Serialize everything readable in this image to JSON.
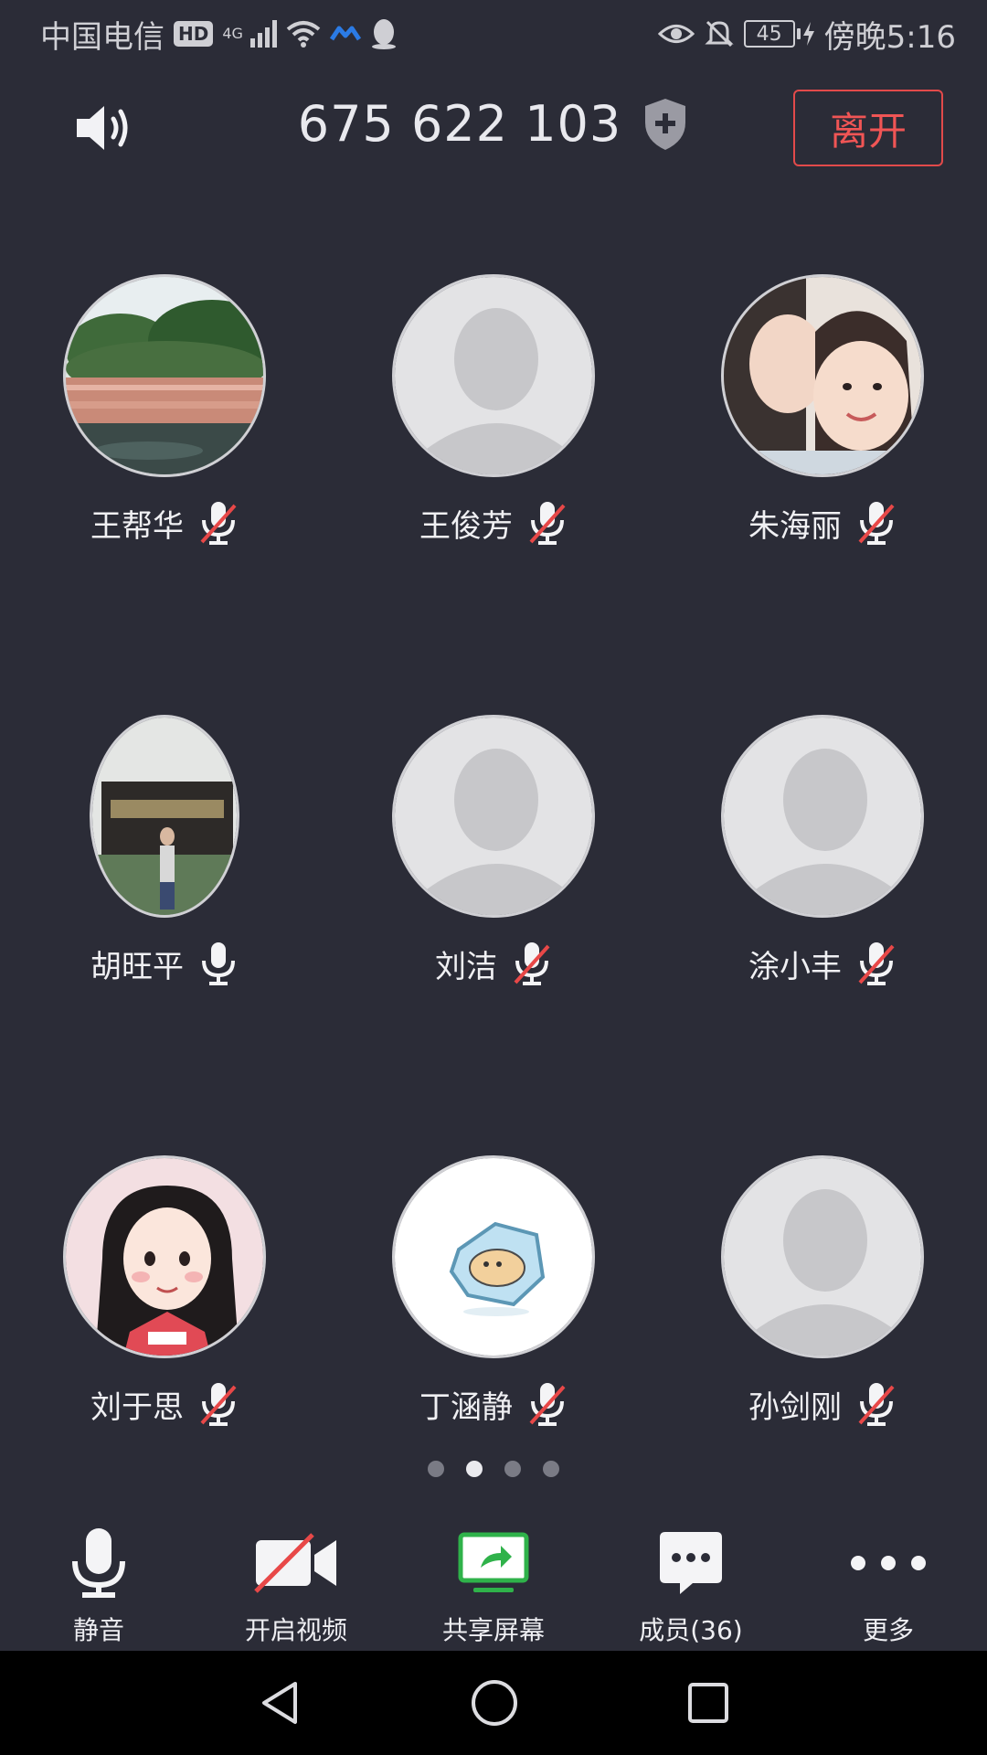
{
  "status_bar": {
    "carrier": "中国电信",
    "hd": "HD",
    "network": "4G",
    "battery": "45",
    "time": "傍晚5:16"
  },
  "header": {
    "meeting_id": "675 622 103",
    "leave_label": "离开"
  },
  "participants": [
    {
      "name": "王帮华",
      "muted": true,
      "avatar": "photo-garden"
    },
    {
      "name": "王俊芳",
      "muted": true,
      "avatar": "default"
    },
    {
      "name": "朱海丽",
      "muted": true,
      "avatar": "photo-family"
    },
    {
      "name": "胡旺平",
      "muted": false,
      "avatar": "photo-man"
    },
    {
      "name": "刘洁",
      "muted": true,
      "avatar": "default"
    },
    {
      "name": "涂小丰",
      "muted": true,
      "avatar": "default"
    },
    {
      "name": "刘于思",
      "muted": true,
      "avatar": "cartoon-girl"
    },
    {
      "name": "丁涵静",
      "muted": true,
      "avatar": "cat"
    },
    {
      "name": "孙剑刚",
      "muted": true,
      "avatar": "default"
    }
  ],
  "pagination": {
    "pages": 4,
    "current": 2
  },
  "toolbar": {
    "mute_label": "静音",
    "video_label": "开启视频",
    "share_label": "共享屏幕",
    "members_label": "成员(36)",
    "more_label": "更多"
  },
  "colors": {
    "background": "#2b2c37",
    "leave_red": "#f05555",
    "share_green": "#2fb24a"
  }
}
